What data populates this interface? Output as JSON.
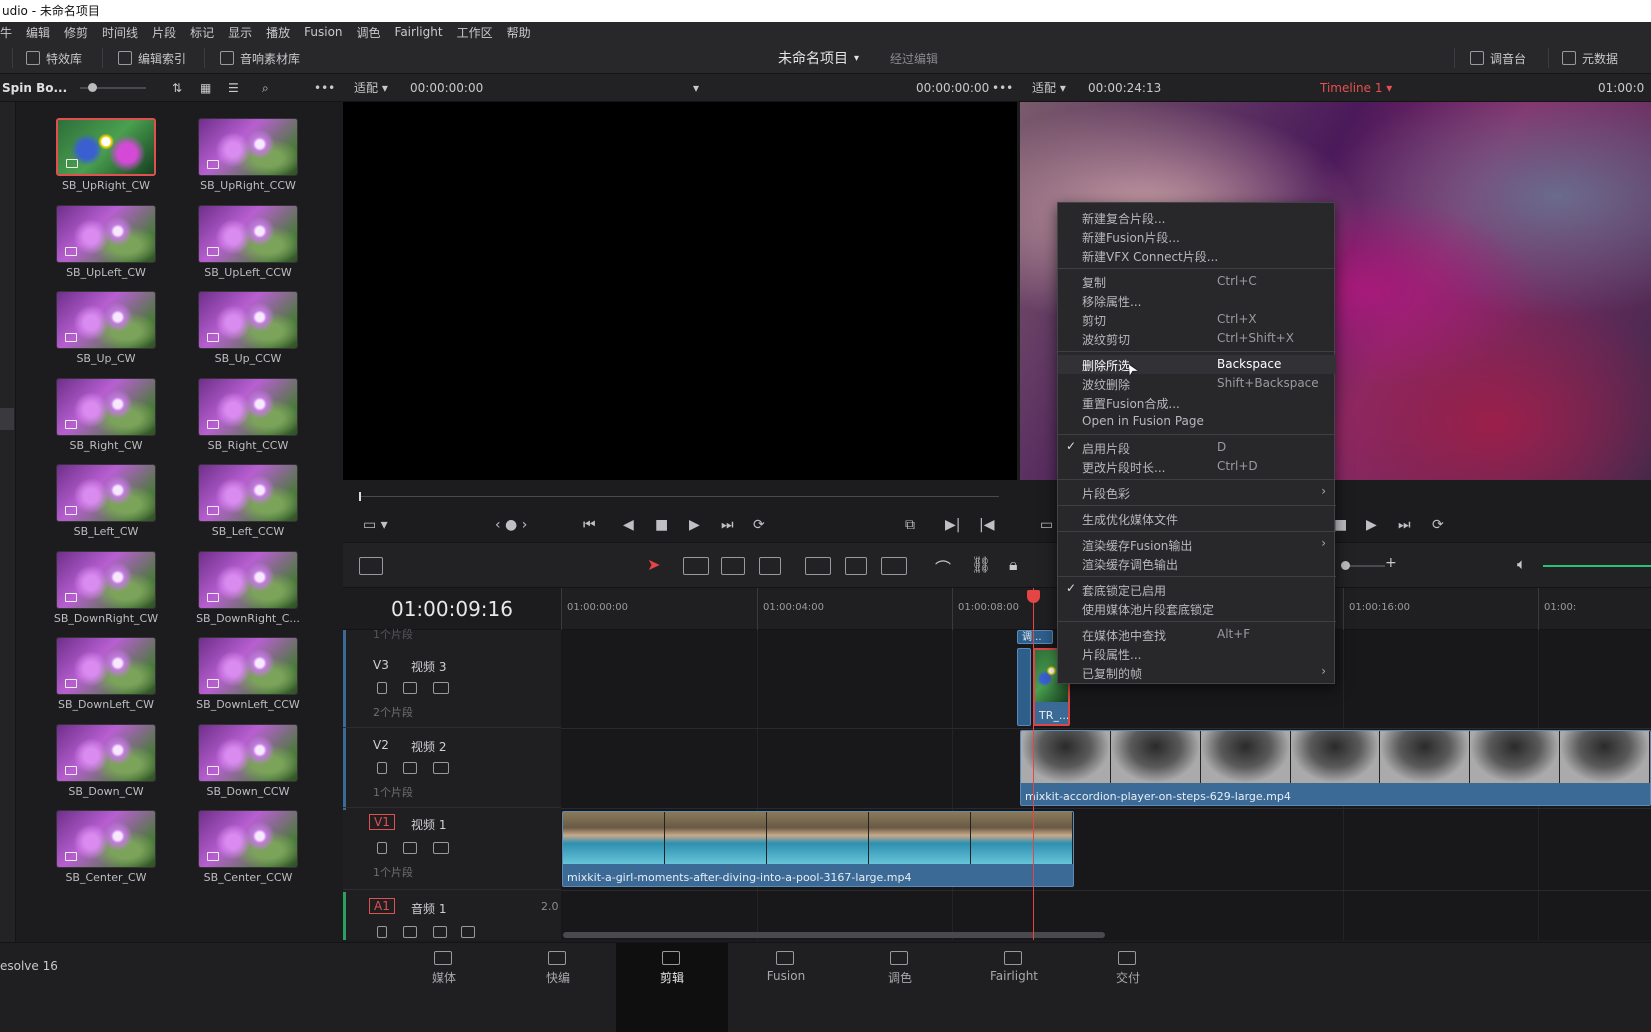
{
  "title_bar": "udio - 未命名项目",
  "menubar": [
    "牛",
    "编辑",
    "修剪",
    "时间线",
    "片段",
    "标记",
    "显示",
    "播放",
    "Fusion",
    "调色",
    "Fairlight",
    "工作区",
    "帮助"
  ],
  "toolbar": {
    "effects": "特效库",
    "edit_index": "编辑索引",
    "sound_library": "音响素材库",
    "project_name": "未命名项目",
    "project_state": "经过编辑",
    "mixer": "调音台",
    "metadata": "元数据"
  },
  "left_panel": {
    "title": "Spin Bo...",
    "items": [
      "SB_UpRight_CW",
      "SB_UpRight_CCW",
      "SB_UpLeft_CW",
      "SB_UpLeft_CCW",
      "SB_Up_CW",
      "SB_Up_CCW",
      "SB_Right_CW",
      "SB_Right_CCW",
      "SB_Left_CW",
      "SB_Left_CCW",
      "SB_DownRight_CW",
      "SB_DownRight_C...",
      "SB_DownLeft_CW",
      "SB_DownLeft_CCW",
      "SB_Down_CW",
      "SB_Down_CCW",
      "SB_Center_CW",
      "SB_Center_CCW"
    ]
  },
  "source_viewer": {
    "fit": "适配",
    "timecode_in": "00:00:00:00",
    "timecode_out": "00:00:00:00"
  },
  "program_viewer": {
    "fit": "适配",
    "duration": "00:00:24:13",
    "timeline_name": "Timeline 1",
    "timecode": "01:00:0"
  },
  "timeline": {
    "current_timecode": "01:00:09:16",
    "ruler": [
      "01:00:00:00",
      "01:00:04:00",
      "01:00:08:00",
      "01:00:16:00",
      "01:00:"
    ],
    "tracks": [
      {
        "id": "V3",
        "name": "视频 3",
        "count": "2个片段"
      },
      {
        "id": "V2",
        "name": "视频 2",
        "count": "1个片段"
      },
      {
        "id": "V1",
        "name": "视频 1",
        "count": "1个片段"
      },
      {
        "id": "A1",
        "name": "音频 1",
        "level": "2.0"
      }
    ],
    "top_hidden_count": "1个片段",
    "clips": {
      "v3_top": "调...",
      "v3_clip": "TR_...",
      "v2_clip": "mixkit-accordion-player-on-steps-629-large.mp4",
      "v1_clip": "mixkit-a-girl-moments-after-diving-into-a-pool-3167-large.mp4"
    }
  },
  "context_menu": {
    "groups": [
      [
        {
          "label": "新建复合片段..."
        },
        {
          "label": "新建Fusion片段..."
        },
        {
          "label": "新建VFX Connect片段..."
        }
      ],
      [
        {
          "label": "复制",
          "shortcut": "Ctrl+C"
        },
        {
          "label": "移除属性..."
        },
        {
          "label": "剪切",
          "shortcut": "Ctrl+X"
        },
        {
          "label": "波纹剪切",
          "shortcut": "Ctrl+Shift+X"
        }
      ],
      [
        {
          "label": "删除所选",
          "shortcut": "Backspace",
          "highlight": true
        },
        {
          "label": "波纹删除",
          "shortcut": "Shift+Backspace"
        },
        {
          "label": "重置Fusion合成..."
        },
        {
          "label": "Open in Fusion Page"
        }
      ],
      [
        {
          "label": "启用片段",
          "shortcut": "D",
          "checked": true
        },
        {
          "label": "更改片段时长...",
          "shortcut": "Ctrl+D"
        }
      ],
      [
        {
          "label": "片段色彩",
          "submenu": true
        }
      ],
      [
        {
          "label": "生成优化媒体文件"
        }
      ],
      [
        {
          "label": "渲染缓存Fusion输出",
          "submenu": true
        },
        {
          "label": "渲染缓存调色输出"
        }
      ],
      [
        {
          "label": "套底锁定已启用",
          "checked": true
        },
        {
          "label": "使用媒体池片段套底锁定"
        }
      ],
      [
        {
          "label": "在媒体池中查找",
          "shortcut": "Alt+F"
        },
        {
          "label": "片段属性..."
        },
        {
          "label": "已复制的帧",
          "submenu": true
        }
      ]
    ]
  },
  "pagebar": {
    "app_version": "esolve 16",
    "pages": [
      "媒体",
      "快编",
      "剪辑",
      "Fusion",
      "调色",
      "Fairlight",
      "交付"
    ],
    "active_index": 2
  },
  "colors": {
    "accent_red": "#e64545",
    "clip_blue": "#3a6a95",
    "menu_bg": "#28282b"
  }
}
